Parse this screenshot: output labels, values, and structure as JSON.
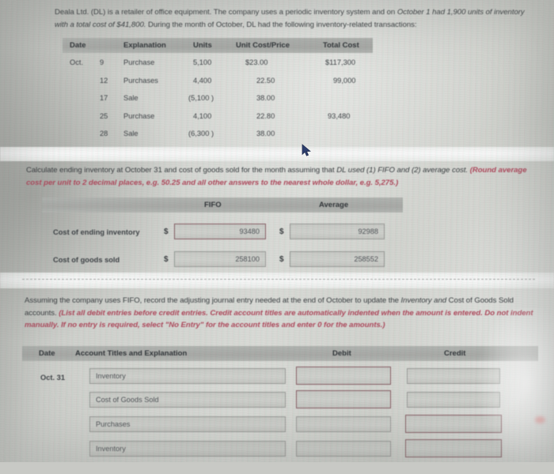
{
  "intro": {
    "line1": "Deala Ltd. (DL) is a retailer of office equipment. The company uses a periodic inventory system and on ",
    "line1_italic": "October 1 had 1,900 units of",
    "line2_italic": "inventory with a total cost of $41,800.",
    "line2": " During the month of October, DL had the following inventory-related transactions:"
  },
  "txn_table": {
    "headers": [
      "Date",
      "Explanation",
      "Units",
      "Unit Cost/Price",
      "Total Cost"
    ],
    "rows": [
      {
        "month": "Oct.",
        "day": "9",
        "explanation": "Purchase",
        "units": "5,100",
        "unit_cost": "$23.00",
        "total_cost": "$117,300"
      },
      {
        "month": "",
        "day": "12",
        "explanation": "Purchases",
        "units": "4,400",
        "unit_cost": "22.50",
        "total_cost": "99,000"
      },
      {
        "month": "",
        "day": "17",
        "explanation": "Sale",
        "units": "(5,100  )",
        "unit_cost": "38.00",
        "total_cost": ""
      },
      {
        "month": "",
        "day": "25",
        "explanation": "Purchase",
        "units": "4,100",
        "unit_cost": "22.80",
        "total_cost": "93,480"
      },
      {
        "month": "",
        "day": "28",
        "explanation": "Sale",
        "units": "(6,300  )",
        "unit_cost": "38.00",
        "total_cost": ""
      }
    ]
  },
  "q1": {
    "text_a": "Calculate ending inventory at October 31 and cost of goods sold for the month assuming that ",
    "text_a_italic": "DL used (1) FIFO and (2) average",
    "text_b_italic": "cost.",
    "text_red": "(Round average cost per unit to 2 decimal places, e.g. 50.25 and all other answers to the nearest whole dollar, e.g. 5,275.)"
  },
  "fifo_table": {
    "col_fifo": "FIFO",
    "col_average": "Average",
    "currency": "$",
    "rows": [
      {
        "label": "Cost of ending inventory",
        "fifo": "93480",
        "average": "92988"
      },
      {
        "label": "Cost of goods sold",
        "fifo": "258100",
        "average": "258552"
      }
    ]
  },
  "q2": {
    "text_a": "Assuming the company uses FIFO, record the adjusting journal entry needed at the end of October to update the ",
    "text_a_italic": "Inventory and",
    "text_b": "Cost of Goods Sold accounts. ",
    "text_red_1": "(List all debit entries before credit entries. Credit account titles are automatically indented when the",
    "text_red_2": "amount is entered. Do not indent manually. If no entry is required, select \"No Entry\" for the account titles and enter 0 for the amounts.)"
  },
  "journal": {
    "headers": [
      "Date",
      "Account Titles and Explanation",
      "Debit",
      "Credit"
    ],
    "date": "Oct. 31",
    "rows": [
      {
        "account": "Inventory",
        "debit": "",
        "credit": "",
        "debit_highlight": true,
        "credit_highlight": false
      },
      {
        "account": "Cost of Goods Sold",
        "debit": "",
        "credit": "",
        "debit_highlight": true,
        "credit_highlight": false
      },
      {
        "account": "Purchases",
        "debit": "",
        "credit": "",
        "debit_highlight": false,
        "credit_highlight": true
      },
      {
        "account": "Inventory",
        "debit": "",
        "credit": "",
        "debit_highlight": false,
        "credit_highlight": true
      }
    ]
  },
  "colors": {
    "accent_red": "#c0425a",
    "header_gray": "#b0b2ae",
    "input_fill": "#cfd0cb"
  },
  "cursor": {
    "name": "mouse-pointer"
  }
}
